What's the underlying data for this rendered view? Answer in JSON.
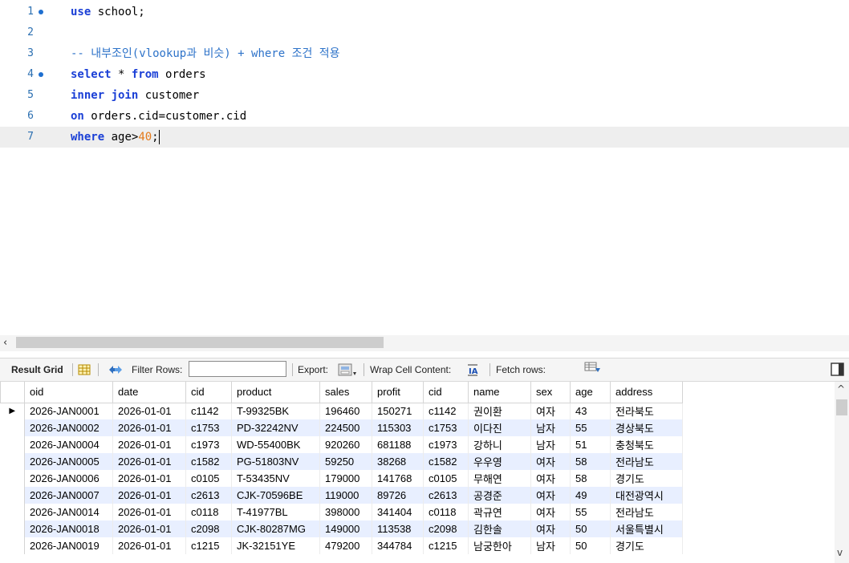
{
  "editor": {
    "lines": [
      {
        "num": "1",
        "bp": true,
        "html": "<span class=\"kw\">use</span> school;"
      },
      {
        "num": "2",
        "bp": false,
        "html": ""
      },
      {
        "num": "3",
        "bp": false,
        "html": "<span class=\"cm\">-- 내부조인(vlookup과 비슷) + where 조건 적용</span>"
      },
      {
        "num": "4",
        "bp": true,
        "html": "<span class=\"kw\">select</span> * <span class=\"kw\">from</span> orders"
      },
      {
        "num": "5",
        "bp": false,
        "html": "<span class=\"kw\">inner join</span> customer"
      },
      {
        "num": "6",
        "bp": false,
        "html": "<span class=\"kw\">on</span> orders.cid=customer.cid"
      },
      {
        "num": "7",
        "bp": false,
        "html": "<span class=\"kw\">where</span> age&gt;<span class=\"num\">40</span>;",
        "current": true
      }
    ]
  },
  "toolbar": {
    "result_grid": "Result Grid",
    "filter_rows": "Filter Rows:",
    "filter_value": "",
    "export": "Export:",
    "wrap_cell": "Wrap Cell Content:",
    "fetch_rows": "Fetch rows:"
  },
  "grid": {
    "columns": [
      "oid",
      "date",
      "cid",
      "product",
      "sales",
      "profit",
      "cid",
      "name",
      "sex",
      "age",
      "address"
    ],
    "rows": [
      [
        "2026-JAN0001",
        "2026-01-01",
        "c1142",
        "T-99325BK",
        "196460",
        "150271",
        "c1142",
        "권이환",
        "여자",
        "43",
        "전라북도"
      ],
      [
        "2026-JAN0002",
        "2026-01-01",
        "c1753",
        "PD-32242NV",
        "224500",
        "115303",
        "c1753",
        "이다진",
        "남자",
        "55",
        "경상북도"
      ],
      [
        "2026-JAN0004",
        "2026-01-01",
        "c1973",
        "WD-55400BK",
        "920260",
        "681188",
        "c1973",
        "강하니",
        "남자",
        "51",
        "충청북도"
      ],
      [
        "2026-JAN0005",
        "2026-01-01",
        "c1582",
        "PG-51803NV",
        "59250",
        "38268",
        "c1582",
        "우우영",
        "여자",
        "58",
        "전라남도"
      ],
      [
        "2026-JAN0006",
        "2026-01-01",
        "c0105",
        "T-53435NV",
        "179000",
        "141768",
        "c0105",
        "무해연",
        "여자",
        "58",
        "경기도"
      ],
      [
        "2026-JAN0007",
        "2026-01-01",
        "c2613",
        "CJK-70596BE",
        "119000",
        "89726",
        "c2613",
        "공경준",
        "여자",
        "49",
        "대전광역시"
      ],
      [
        "2026-JAN0014",
        "2026-01-01",
        "c0118",
        "T-41977BL",
        "398000",
        "341404",
        "c0118",
        "곽규연",
        "여자",
        "55",
        "전라남도"
      ],
      [
        "2026-JAN0018",
        "2026-01-01",
        "c2098",
        "CJK-80287MG",
        "149000",
        "113538",
        "c2098",
        "김한솔",
        "여자",
        "50",
        "서울특별시"
      ],
      [
        "2026-JAN0019",
        "2026-01-01",
        "c1215",
        "JK-32151YE",
        "479200",
        "344784",
        "c1215",
        "남궁한아",
        "남자",
        "50",
        "경기도"
      ]
    ]
  },
  "icons": {
    "scroll_left": "‹",
    "scroll_up": "^",
    "scroll_down": "v",
    "row_pointer": "▶"
  }
}
